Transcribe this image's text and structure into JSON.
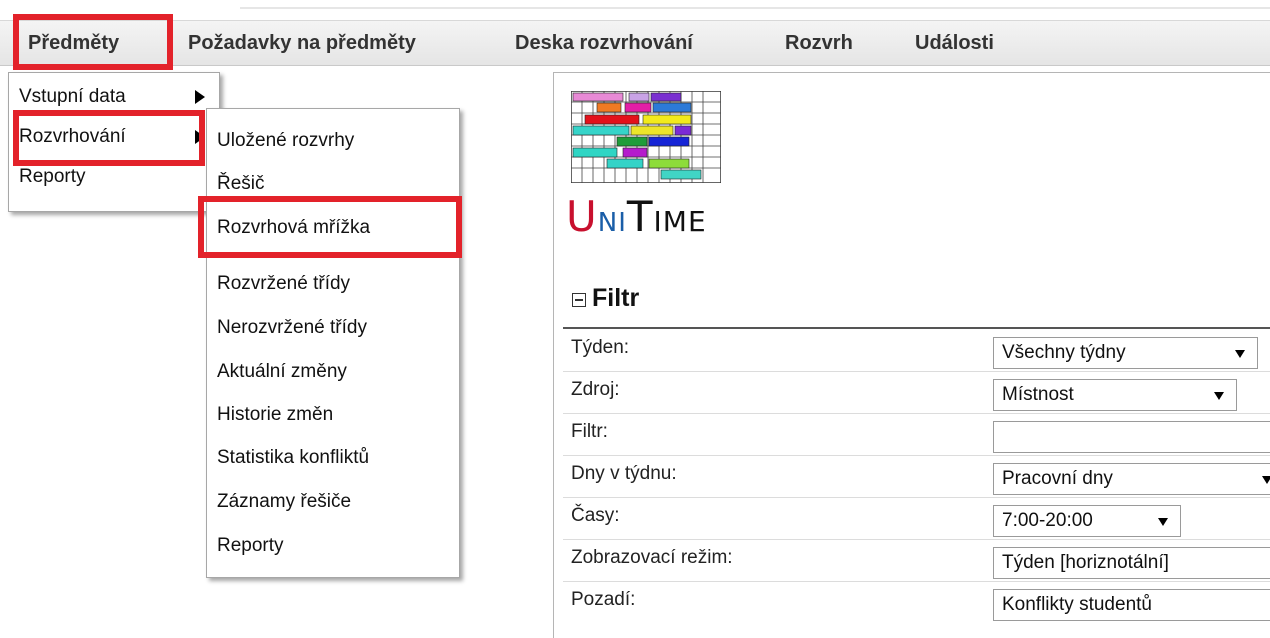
{
  "menubar": {
    "items": [
      "Předměty",
      "Požadavky na předměty",
      "Deska rozvrhování",
      "Rozvrh",
      "Události"
    ]
  },
  "dropdown": {
    "items": [
      "Vstupní data",
      "Rozvrhování",
      "Reporty"
    ]
  },
  "submenu": {
    "items": [
      "Uložené rozvrhy",
      "Řešič",
      "Rozvrhová mřížka",
      "Rozvržené třídy",
      "Nerozvržené třídy",
      "Aktuální změny",
      "Historie změn",
      "Statistika konfliktů",
      "Záznamy řešiče",
      "Reporty"
    ]
  },
  "logo": {
    "u": "U",
    "ni": "NI",
    "t": "T",
    "ime": "IME"
  },
  "filter": {
    "title": "Filtr",
    "rows": [
      {
        "label": "Týden:",
        "value": "Všechny týdny"
      },
      {
        "label": "Zdroj:",
        "value": "Místnost"
      },
      {
        "label": "Filtr:",
        "value": ""
      },
      {
        "label": "Dny v týdnu:",
        "value": "Pracovní dny"
      },
      {
        "label": "Časy:",
        "value": "7:00-20:00"
      },
      {
        "label": "Zobrazovací režim:",
        "value": "Týden [horiznotální]"
      },
      {
        "label": "Pozadí:",
        "value": "Konflikty studentů"
      }
    ]
  },
  "colors": {
    "highlight": "#e3222a",
    "menubar_text": "#333333"
  }
}
